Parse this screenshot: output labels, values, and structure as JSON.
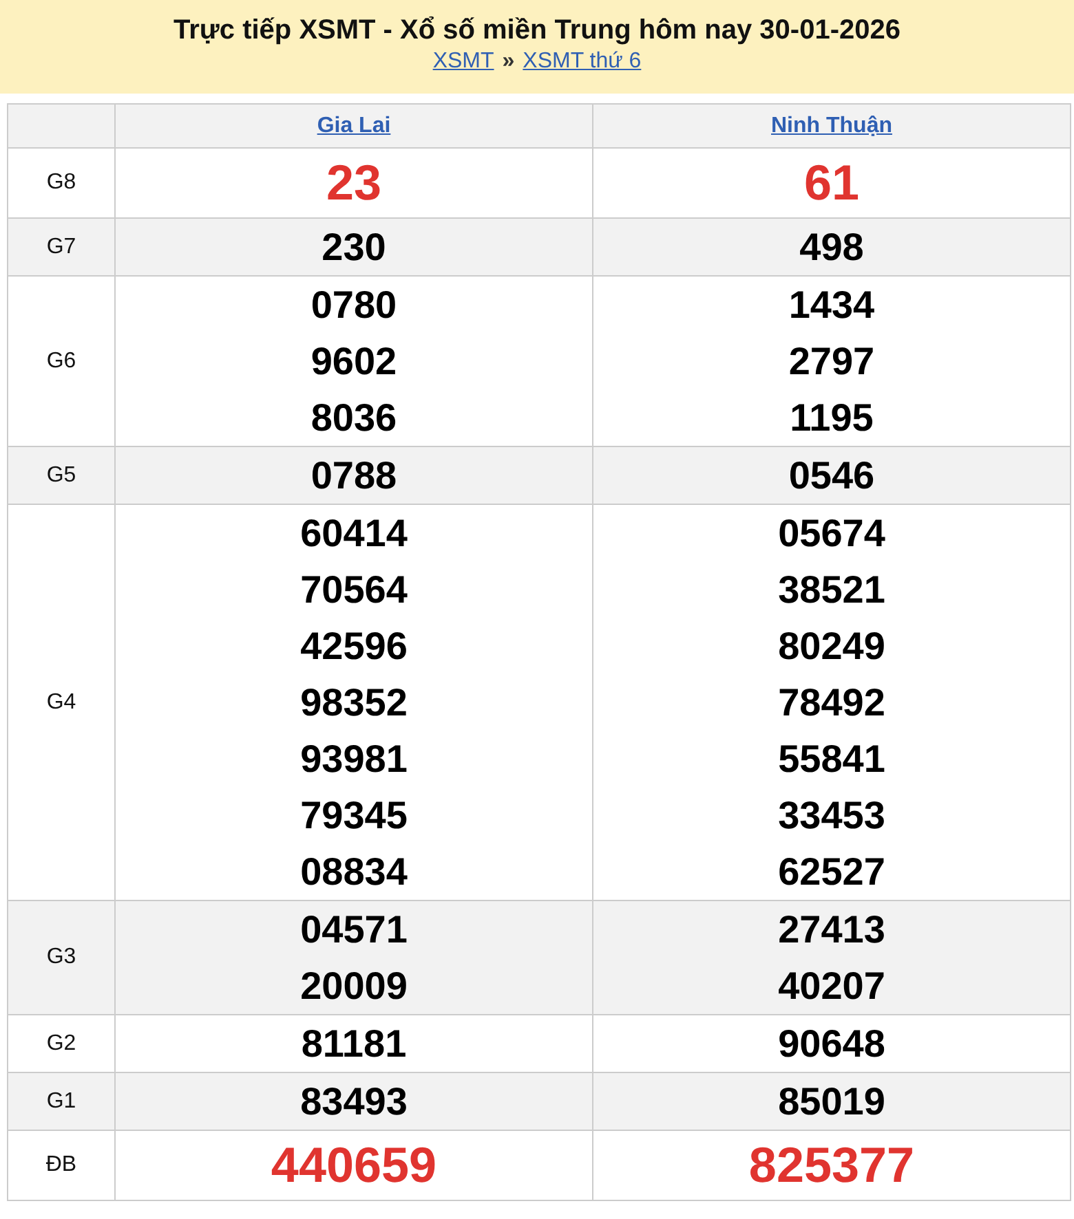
{
  "header": {
    "title": "Trực tiếp XSMT - Xổ số miền Trung hôm nay 30-01-2026",
    "breadcrumb": [
      "XSMT",
      "XSMT thứ 6"
    ],
    "separator": "»"
  },
  "provinces": [
    "Gia Lai",
    "Ninh Thuận"
  ],
  "prizes": [
    {
      "label": "G8",
      "kind": "big",
      "values": [
        [
          "23"
        ],
        [
          "61"
        ]
      ]
    },
    {
      "label": "G7",
      "kind": "plain",
      "values": [
        [
          "230"
        ],
        [
          "498"
        ]
      ]
    },
    {
      "label": "G6",
      "kind": "plain",
      "values": [
        [
          "0780",
          "9602",
          "8036"
        ],
        [
          "1434",
          "2797",
          "1195"
        ]
      ]
    },
    {
      "label": "G5",
      "kind": "plain",
      "values": [
        [
          "0788"
        ],
        [
          "0546"
        ]
      ]
    },
    {
      "label": "G4",
      "kind": "plain",
      "values": [
        [
          "60414",
          "70564",
          "42596",
          "98352",
          "93981",
          "79345",
          "08834"
        ],
        [
          "05674",
          "38521",
          "80249",
          "78492",
          "55841",
          "33453",
          "62527"
        ]
      ]
    },
    {
      "label": "G3",
      "kind": "plain",
      "values": [
        [
          "04571",
          "20009"
        ],
        [
          "27413",
          "40207"
        ]
      ]
    },
    {
      "label": "G2",
      "kind": "plain",
      "values": [
        [
          "81181"
        ],
        [
          "90648"
        ]
      ]
    },
    {
      "label": "G1",
      "kind": "plain",
      "values": [
        [
          "83493"
        ],
        [
          "85019"
        ]
      ]
    },
    {
      "label": "ĐB",
      "kind": "big",
      "values": [
        [
          "440659"
        ],
        [
          "825377"
        ]
      ]
    }
  ]
}
